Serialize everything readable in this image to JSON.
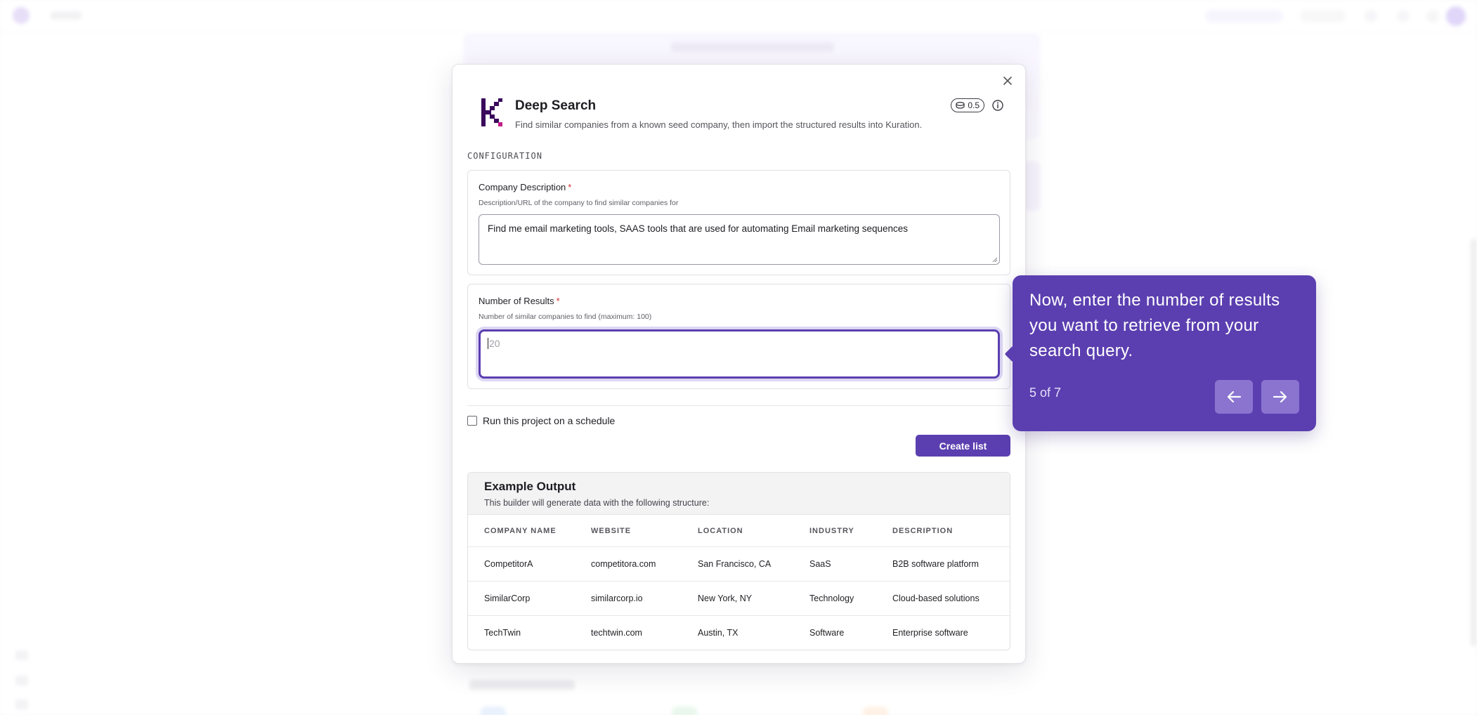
{
  "modal": {
    "title": "Deep Search",
    "subtitle": "Find similar companies from a known seed company, then import the structured results into Kuration.",
    "credit_cost": "0.5",
    "config_label": "CONFIGURATION",
    "company_description": {
      "label": "Company Description",
      "required_mark": "*",
      "help": "Description/URL of the company to find similar companies for",
      "value": "Find me email marketing tools, SAAS tools that are used for automating Email marketing sequences"
    },
    "number_of_results": {
      "label": "Number of Results",
      "required_mark": "*",
      "help": "Number of similar companies to find (maximum: 100)",
      "placeholder": "20"
    },
    "schedule_label": "Run this project on a schedule",
    "create_button": "Create list",
    "example_output": {
      "title": "Example Output",
      "subtitle": "This builder will generate data with the following structure:",
      "columns": [
        "COMPANY NAME",
        "WEBSITE",
        "LOCATION",
        "INDUSTRY",
        "DESCRIPTION"
      ],
      "rows": [
        [
          "CompetitorA",
          "competitora.com",
          "San Francisco, CA",
          "SaaS",
          "B2B software platform"
        ],
        [
          "SimilarCorp",
          "similarcorp.io",
          "New York, NY",
          "Technology",
          "Cloud-based solutions"
        ],
        [
          "TechTwin",
          "techtwin.com",
          "Austin, TX",
          "Software",
          "Enterprise software"
        ]
      ]
    }
  },
  "tour": {
    "text": "Now, enter the number of results you want to retrieve from your search query.",
    "step": "5 of 7"
  },
  "colors": {
    "accent": "#5b3fb0",
    "tooltip_button": "#8a74d0",
    "required": "#d42c2c"
  },
  "icons": {
    "close": "close-icon",
    "info": "info-icon",
    "credit": "coin-stack-icon",
    "prev": "arrow-left-icon",
    "next": "arrow-right-icon",
    "brand": "kuration-logo"
  }
}
